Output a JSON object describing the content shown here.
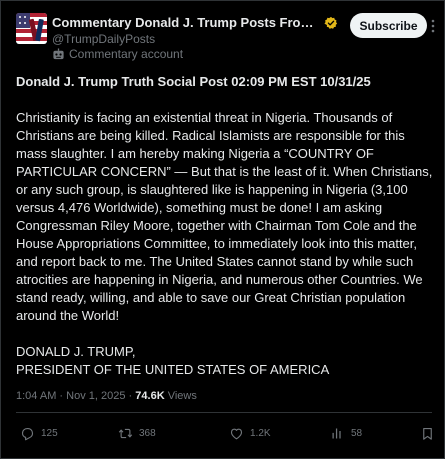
{
  "account": {
    "display_name": "Commentary Donald J. Trump Posts From Truth ...",
    "handle": "@TrumpDailyPosts",
    "account_type": "Commentary account",
    "subscribe_label": "Subscribe",
    "verified_color": "#e2b719"
  },
  "post": {
    "title_prefix": "Donald J. Trump Truth Social Post",
    "title_time": "02:09 PM EST 10/31/25",
    "lines": [
      "Christianity is facing an existential threat in Nigeria. Thousands of",
      "Christians are being killed. Radical Islamists are responsible for this",
      "mass slaughter. I am hereby making Nigeria a “COUNTRY OF",
      "PARTICULAR CONCERN” — But that is the least of it. When Christians,",
      "or any such group, is slaughtered like is happening in Nigeria (3,100",
      "versus 4,476 Worldwide), something must be done! I am asking",
      "Congressman Riley Moore, together with Chairman Tom Cole and the",
      "House Appropriations Committee, to immediately look into this matter,",
      "and report back to me. The United States cannot stand by while such",
      "atrocities are happening in Nigeria, and numerous other Countries. We",
      "stand ready, willing, and able to save our Great Christian population",
      "around the World!"
    ],
    "signature_line1": "DONALD J. TRUMP,",
    "signature_line2": "PRESIDENT OF THE UNITED STATES OF AMERICA"
  },
  "meta": {
    "time": "1:04 AM",
    "separator": "·",
    "date": "Nov 1, 2025",
    "views_count": "74.6K",
    "views_label": "Views"
  },
  "actions": {
    "replies": "125",
    "reposts": "368",
    "likes": "1.2K",
    "views": "58"
  },
  "icons": {
    "reply": "reply-icon",
    "repost": "repost-icon",
    "like": "heart-icon",
    "views": "views-icon",
    "bookmark": "bookmark-icon",
    "more": "more-icon",
    "robot": "robot-icon"
  }
}
